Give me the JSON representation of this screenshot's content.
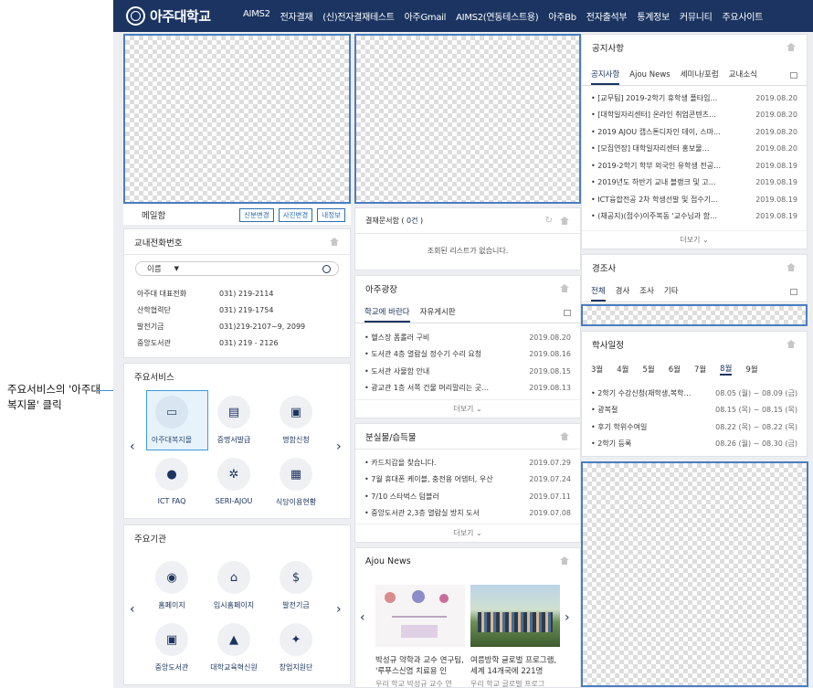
{
  "annotation": {
    "text": "주요서비스의 '아주대복지몰' 클릭"
  },
  "header": {
    "logo_text": "아주대학교",
    "nav": [
      "AIMS2",
      "전자결재",
      "(신)전자결재테스트",
      "아주Gmail",
      "AIMS2(연동테스트용)",
      "아주Bb",
      "전자출석부",
      "통계정보",
      "커뮤니티",
      "주요사이트"
    ]
  },
  "mail": {
    "label": "메일함",
    "buttons": [
      "신분변경",
      "사진변경",
      "내정보"
    ]
  },
  "phone": {
    "title": "교내전화번호",
    "search_select": "이름",
    "entries": [
      {
        "name": "아주대 대표전화",
        "number": "031) 219-2114"
      },
      {
        "name": "산학협력단",
        "number": "031) 219-1754"
      },
      {
        "name": "발전기금",
        "number": "031)219-2107~9, 2099"
      },
      {
        "name": "중앙도서관",
        "number": "031) 219 - 2126"
      }
    ]
  },
  "services": {
    "title": "주요서비스",
    "items": [
      {
        "label": "아주대복지몰",
        "glyph": "▭",
        "icon": "basket-icon"
      },
      {
        "label": "증명서발급",
        "glyph": "▤",
        "icon": "certificate-icon"
      },
      {
        "label": "명함신청",
        "glyph": "▣",
        "icon": "business-card-icon"
      },
      {
        "label": "ICT FAQ",
        "glyph": "●",
        "icon": "chat-icon"
      },
      {
        "label": "SERI-AJOU",
        "glyph": "✲",
        "icon": "chip-icon"
      },
      {
        "label": "식당이용현황",
        "glyph": "▦",
        "icon": "menu-icon"
      }
    ]
  },
  "orgs": {
    "title": "주요기관",
    "items": [
      {
        "label": "홈페이지",
        "glyph": "◉",
        "icon": "university-seal-icon"
      },
      {
        "label": "입시홈페이지",
        "glyph": "⌂",
        "icon": "admission-icon"
      },
      {
        "label": "발전기금",
        "glyph": "$",
        "icon": "fund-icon"
      },
      {
        "label": "중앙도서관",
        "glyph": "▣",
        "icon": "library-icon"
      },
      {
        "label": "대학교육혁신원",
        "glyph": "▲",
        "icon": "innovation-icon"
      },
      {
        "label": "창업지원단",
        "glyph": "✦",
        "icon": "startup-icon"
      }
    ]
  },
  "approval": {
    "title": "결재문서함",
    "count": "0건",
    "empty": "조회된 리스트가 없습니다."
  },
  "plaza": {
    "title": "아주광장",
    "tabs": [
      "학교에 바란다",
      "자유게시판"
    ],
    "items": [
      {
        "title": "헬스장 폼롤러 구비",
        "date": "2019.08.20"
      },
      {
        "title": "도서관 4층 열람실 정수기 수리 요청",
        "date": "2019.08.16"
      },
      {
        "title": "도서관 사물함 안내",
        "date": "2019.08.15"
      },
      {
        "title": "광교관 1층 서쪽 건물 머리말리는 곳…",
        "date": "2019.08.13"
      }
    ],
    "more": "더보기"
  },
  "lost": {
    "title": "분실물/습득물",
    "items": [
      {
        "title": "카드지갑을 찾습니다.",
        "date": "2019.07.29"
      },
      {
        "title": "7월 휴대폰 케이블, 충전용 어댑터, 우산",
        "date": "2019.07.24"
      },
      {
        "title": "7/10 스타벅스 텀블러",
        "date": "2019.07.11"
      },
      {
        "title": "중앙도서관 2,3층 열람실 방치 도서",
        "date": "2019.07.08"
      }
    ],
    "more": "더보기"
  },
  "ajounews": {
    "title": "Ajou News",
    "items": [
      {
        "title": "박성규 약학과 교수 연구팀, '루푸스신염 치료용 인",
        "sub": "우리 학교 박성규 교수 연"
      },
      {
        "title": "여름방학 글로벌 프로그램, 세계 14개국에 221명",
        "sub": "우리 학교 글로벌 프로그"
      }
    ]
  },
  "notice": {
    "title": "공지사항",
    "tabs": [
      "공지사항",
      "Ajou News",
      "세미나/포럼",
      "교내소식"
    ],
    "items": [
      {
        "title": "[교무팀] 2019-2학기 휴학생 폴타임…",
        "date": "2019.08.20"
      },
      {
        "title": "[대학일자리센터] 온라인 취업콘텐츠…",
        "date": "2019.08.20"
      },
      {
        "title": "2019 AJOU 캡스톤디자인 데이, 스마…",
        "date": "2019.08.20"
      },
      {
        "title": "[모집연장] 대학일자리센터 홍보물…",
        "date": "2019.08.20"
      },
      {
        "title": "2019-2학기 학부 외국인 유학생 전공…",
        "date": "2019.08.19"
      },
      {
        "title": "2019년도 하반기 교내 블랭크 및 고…",
        "date": "2019.08.19"
      },
      {
        "title": "ICT융합전공 2차 학생선발 및 접수기…",
        "date": "2019.08.19"
      },
      {
        "title": "(채공지)(접수)이주복동 '교수님과 함…",
        "date": "2019.08.19"
      }
    ],
    "more": "더보기"
  },
  "condolence": {
    "title": "경조사",
    "tabs": [
      "전체",
      "경사",
      "조사",
      "기타"
    ]
  },
  "schedule": {
    "title": "학사일정",
    "months": [
      "3월",
      "4월",
      "5월",
      "6월",
      "7월",
      "8월",
      "9월"
    ],
    "active_month": "8월",
    "items": [
      {
        "title": "2학기 수강신청(재학생,복학…",
        "date": "08.05 (월) ~ 08.09 (금)"
      },
      {
        "title": "광복절",
        "date": "08.15 (목) ~ 08.15 (목)"
      },
      {
        "title": "후기 학위수여일",
        "date": "08.22 (목) ~ 08.22 (목)"
      },
      {
        "title": "2학기 등록",
        "date": "08.26 (월) ~ 08.30 (금)"
      }
    ]
  }
}
